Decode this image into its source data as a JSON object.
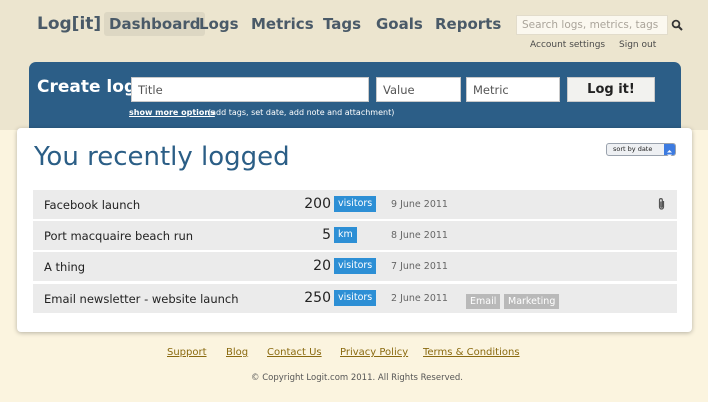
{
  "header": {
    "logo": "Log[it]",
    "nav": [
      "Dashboard",
      "Logs",
      "Metrics",
      "Tags",
      "Goals",
      "Reports"
    ],
    "active_nav": "Dashboard",
    "search_placeholder": "Search logs, metrics, tags",
    "account_settings": "Account settings",
    "sign_out": "Sign out"
  },
  "create_log": {
    "title": "Create log",
    "title_placeholder": "Title",
    "value_placeholder": "Value",
    "metric_placeholder": "Metric",
    "submit_label": "Log it!",
    "more_options": "show more options",
    "more_hint": "(add tags, set date, add note and attachment)"
  },
  "recent": {
    "title": "You recently logged",
    "sort_label": "sort by date",
    "rows": [
      {
        "name": "Facebook launch",
        "value": "200",
        "unit": "visitors",
        "date": "9 June 2011",
        "tags": [],
        "has_attachment": true
      },
      {
        "name": "Port macquaire beach run",
        "value": "5",
        "unit": "km",
        "date": "8 June 2011",
        "tags": [],
        "has_attachment": false
      },
      {
        "name": "A thing",
        "value": "20",
        "unit": "visitors",
        "date": "7 June 2011",
        "tags": [],
        "has_attachment": false
      },
      {
        "name": "Email newsletter - website launch",
        "value": "250",
        "unit": "visitors",
        "date": "2 June 2011",
        "tags": [
          "Email",
          "Marketing"
        ],
        "has_attachment": false
      }
    ]
  },
  "footer": {
    "links": [
      "Support",
      "Blog",
      "Contact Us",
      "Privacy Policy",
      "Terms & Conditions"
    ],
    "copyright": "© Copyright Logit.com 2011. All Rights Reserved."
  },
  "colors": {
    "panel_blue": "#2c5e87",
    "unit_badge": "#2d8fd5",
    "tag_grey": "#b9b9b9",
    "footer_link": "#8a6a10"
  }
}
